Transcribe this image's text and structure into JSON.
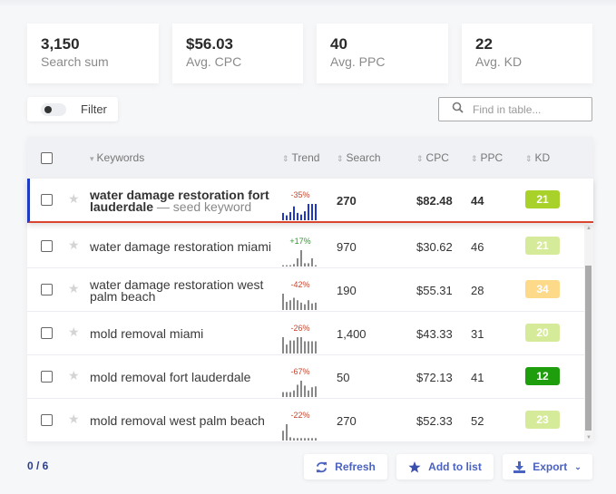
{
  "stats": [
    {
      "value": "3,150",
      "label": "Search sum"
    },
    {
      "value": "$56.03",
      "label": "Avg. CPC"
    },
    {
      "value": "40",
      "label": "Avg. PPC"
    },
    {
      "value": "22",
      "label": "Avg. KD"
    }
  ],
  "filter": {
    "label": "Filter",
    "enabled": false
  },
  "search": {
    "placeholder": "Find in table...",
    "value": "",
    "icon": "search-icon"
  },
  "table": {
    "columns": {
      "keywords": "Keywords",
      "trend": "Trend",
      "search": "Search",
      "cpc": "CPC",
      "ppc": "PPC",
      "kd": "KD"
    },
    "sort_icons": {
      "keywords": "▾",
      "others": "⇕"
    },
    "rows": [
      {
        "keyword": "water damage restoration fort lauderdale",
        "seed_tag": "— seed keyword",
        "seed": true,
        "trend_pct": "-35%",
        "trend_dir": "neg",
        "trend": [
          0.45,
          0.3,
          0.5,
          0.85,
          0.45,
          0.35,
          0.55,
          1,
          1,
          1
        ],
        "trend_color": "#2138c4",
        "search": "270",
        "cpc": "$82.48",
        "ppc": "44",
        "kd": "21",
        "kd_color": "#a8d12a"
      },
      {
        "keyword": "water damage restoration miami",
        "seed_tag": "",
        "seed": false,
        "trend_pct": "+17%",
        "trend_dir": "pos",
        "trend": [
          0.08,
          0.08,
          0.08,
          0.15,
          0.5,
          1,
          0.2,
          0.2,
          0.5,
          0.08
        ],
        "trend_color": "#888",
        "search": "970",
        "cpc": "$30.62",
        "ppc": "46",
        "kd": "21",
        "kd_color": "#d6eb9a"
      },
      {
        "keyword": "water damage restoration west palm beach",
        "seed_tag": "",
        "seed": false,
        "trend_pct": "-42%",
        "trend_dir": "neg",
        "trend": [
          1,
          0.5,
          0.6,
          0.75,
          0.6,
          0.45,
          0.35,
          0.6,
          0.4,
          0.45
        ],
        "trend_color": "#888",
        "search": "190",
        "cpc": "$55.31",
        "ppc": "28",
        "kd": "34",
        "kd_color": "#fdd98a"
      },
      {
        "keyword": "mold removal miami",
        "seed_tag": "",
        "seed": false,
        "trend_pct": "-26%",
        "trend_dir": "neg",
        "trend": [
          1,
          0.55,
          0.8,
          0.8,
          1,
          1,
          0.75,
          0.75,
          0.75,
          0.75
        ],
        "trend_color": "#888",
        "search": "1,400",
        "cpc": "$43.33",
        "ppc": "31",
        "kd": "20",
        "kd_color": "#d6eb9a"
      },
      {
        "keyword": "mold removal fort lauderdale",
        "seed_tag": "",
        "seed": false,
        "trend_pct": "-67%",
        "trend_dir": "neg",
        "trend": [
          0.3,
          0.3,
          0.3,
          0.4,
          0.75,
          1,
          0.7,
          0.4,
          0.6,
          0.65
        ],
        "trend_color": "#888",
        "search": "50",
        "cpc": "$72.13",
        "ppc": "41",
        "kd": "12",
        "kd_color": "#1e9e0c"
      },
      {
        "keyword": "mold removal west palm beach",
        "seed_tag": "",
        "seed": false,
        "trend_pct": "-22%",
        "trend_dir": "neg",
        "trend": [
          0.6,
          1,
          0.2,
          0.15,
          0.15,
          0.15,
          0.15,
          0.15,
          0.15,
          0.15
        ],
        "trend_color": "#888",
        "search": "270",
        "cpc": "$52.33",
        "ppc": "52",
        "kd": "23",
        "kd_color": "#d6eb9a"
      }
    ]
  },
  "footer": {
    "selection_count": "0 / 6",
    "buttons": {
      "refresh": "Refresh",
      "add_to_list": "Add to list",
      "export": "Export"
    }
  }
}
